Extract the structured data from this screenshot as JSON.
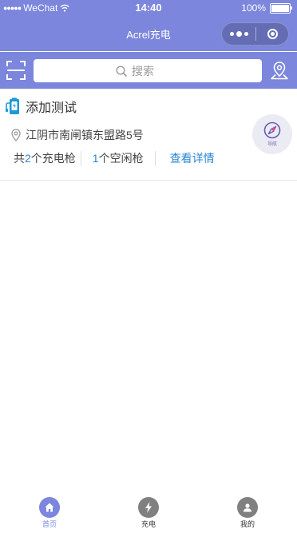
{
  "colors": {
    "primary": "#7b86dc",
    "link": "#2a86d4",
    "tab_inactive": "#808080"
  },
  "status_bar": {
    "carrier": "WeChat",
    "time": "14:40",
    "battery": "100%",
    "battery_level": 1.0
  },
  "nav": {
    "title": "Acrel充电"
  },
  "search": {
    "placeholder": "搜索",
    "value": ""
  },
  "station": {
    "name": "添加测试",
    "address": "江阴市南闸镇东盟路5号",
    "total_prefix": "共",
    "total_count": "2",
    "total_suffix": "个充电枪",
    "idle_count": "1",
    "idle_suffix": "个空闲枪",
    "detail_label": "查看详情",
    "navigate_label": "导航"
  },
  "tabs": [
    {
      "label": "首页",
      "icon": "home-icon",
      "active": true
    },
    {
      "label": "充电",
      "icon": "charge-icon",
      "active": false
    },
    {
      "label": "我的",
      "icon": "profile-icon",
      "active": false
    }
  ]
}
